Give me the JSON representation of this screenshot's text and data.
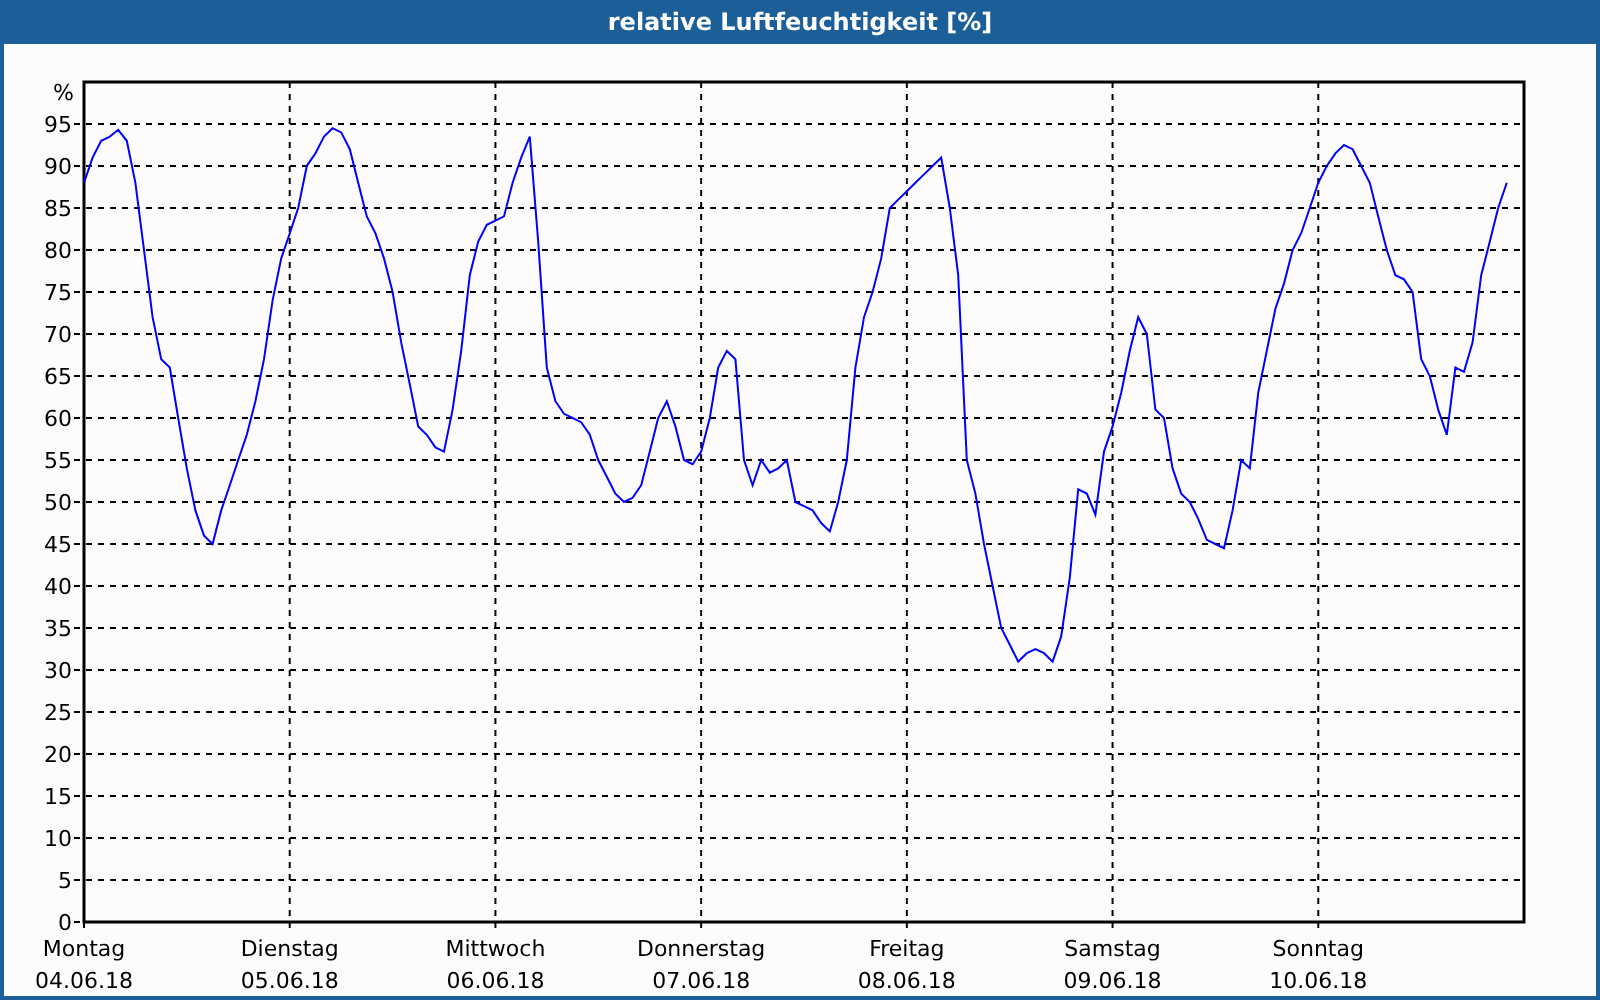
{
  "chart": {
    "x_axis_dates": [
      "04.06.18",
      "05.06.18",
      "06.06.18",
      "07.06.18",
      "08.06.18",
      "09.06.18",
      "10.06.18"
    ],
    "chart_data": {
      "type": "line",
      "title": "relative Luftfeuchtigkeit [%]",
      "ylabel": "%",
      "categories": [
        "Montag",
        null,
        null,
        null,
        null,
        null,
        null,
        null,
        null,
        null,
        null,
        null,
        null,
        null,
        null,
        null,
        null,
        null,
        null,
        null,
        null,
        null,
        null,
        null,
        "Dienstag",
        null,
        null,
        null,
        null,
        null,
        null,
        null,
        null,
        null,
        null,
        null,
        null,
        null,
        null,
        null,
        null,
        null,
        null,
        null,
        null,
        null,
        null,
        null,
        "Mittwoch",
        null,
        null,
        null,
        null,
        null,
        null,
        null,
        null,
        null,
        null,
        null,
        null,
        null,
        null,
        null,
        null,
        null,
        null,
        null,
        null,
        null,
        null,
        null,
        "Donnerstag",
        null,
        null,
        null,
        null,
        null,
        null,
        null,
        null,
        null,
        null,
        null,
        null,
        null,
        null,
        null,
        null,
        null,
        null,
        null,
        null,
        null,
        null,
        null,
        "Freitag",
        null,
        null,
        null,
        null,
        null,
        null,
        null,
        null,
        null,
        null,
        null,
        null,
        null,
        null,
        null,
        null,
        null,
        null,
        null,
        null,
        null,
        null,
        null,
        "Samstag",
        null,
        null,
        null,
        null,
        null,
        null,
        null,
        null,
        null,
        null,
        null,
        null,
        null,
        null,
        null,
        null,
        null,
        null,
        null,
        null,
        null,
        null,
        null,
        "Sonntag",
        null,
        null,
        null,
        null,
        null,
        null,
        null,
        null,
        null,
        null,
        null,
        null,
        null,
        null,
        null,
        null,
        null,
        null,
        null,
        null,
        null,
        null,
        null
      ],
      "grid": true,
      "ylim": [
        0,
        100
      ],
      "yticks": [
        0,
        5,
        10,
        15,
        20,
        25,
        30,
        35,
        40,
        45,
        50,
        55,
        60,
        65,
        70,
        75,
        80,
        85,
        90,
        95
      ],
      "series": [
        {
          "color": "#0000ff",
          "values": [
            88,
            91,
            93,
            93.5,
            94.3,
            93,
            88,
            80,
            72,
            67,
            66,
            60,
            54,
            49,
            46,
            45,
            49,
            52,
            55,
            58,
            62,
            67,
            74,
            79,
            82,
            85,
            90,
            91.5,
            93.5,
            94.5,
            94,
            92,
            88,
            84,
            82,
            79,
            75,
            69,
            64,
            59,
            58,
            56.5,
            56,
            61,
            68,
            77,
            81,
            83,
            83.5,
            84,
            88,
            91,
            93.5,
            81,
            66,
            62,
            60.5,
            60,
            59.5,
            58,
            55,
            53,
            51,
            50,
            50.5,
            52,
            56,
            60,
            62,
            59,
            55,
            54.5,
            56,
            60,
            66,
            68,
            67,
            55,
            52,
            55,
            53.5,
            54,
            55,
            50,
            49.5,
            49,
            47.5,
            46.5,
            50,
            55,
            66,
            72,
            75,
            79,
            85,
            86,
            87,
            88,
            89,
            90,
            91,
            85,
            77,
            55,
            51,
            45,
            40,
            35,
            33,
            31,
            32,
            32.5,
            32,
            31,
            34,
            41,
            51.5,
            51,
            48.5,
            56,
            59,
            63,
            68,
            72,
            70,
            61,
            60,
            54,
            51,
            50,
            48,
            45.5,
            45,
            44.5,
            49,
            55,
            54,
            63,
            68,
            73,
            76,
            80,
            82,
            85,
            88,
            90,
            91.5,
            92.5,
            92,
            90,
            88,
            84,
            80,
            77,
            76.5,
            75,
            67,
            65,
            61,
            58,
            66,
            65.5,
            69,
            77,
            81,
            85,
            88,
            null
          ]
        }
      ]
    }
  }
}
